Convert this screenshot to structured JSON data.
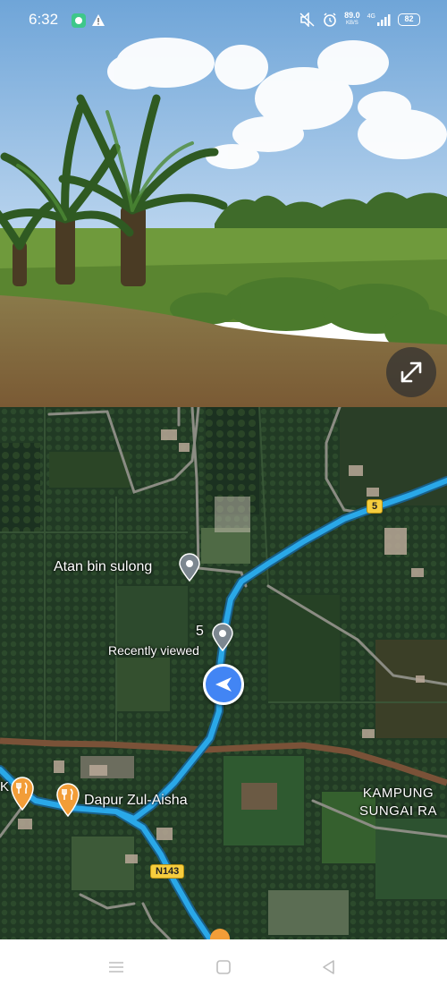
{
  "status_bar": {
    "time": "6:32",
    "notification_icons": [
      "chat-bubble-icon",
      "warning-icon"
    ],
    "speed_value": "89.0",
    "speed_unit": "KB/S",
    "network": "4G",
    "battery": "82",
    "icons": [
      "sound-off-icon",
      "alarm-icon",
      "signal-icon",
      "battery-icon"
    ]
  },
  "street_view": {
    "expand_icon": "expand-icon"
  },
  "map": {
    "places": {
      "atan": "Atan bin sulong",
      "recent_number": "5",
      "recent_label": "Recently viewed",
      "dapur": "Dapur Zul-Aisha",
      "kampung_line1": "KAMPUNG",
      "kampung_line2": "SUNGAI RA",
      "edge_label": "K"
    },
    "road_shields": {
      "route_5": "5",
      "route_n143": "N143"
    },
    "route_color": "#2aa8e8",
    "nav_icon": "navigation-arrow-icon"
  },
  "nav_bar": {
    "icons": [
      "menu-icon",
      "home-square-icon",
      "back-triangle-icon"
    ]
  }
}
